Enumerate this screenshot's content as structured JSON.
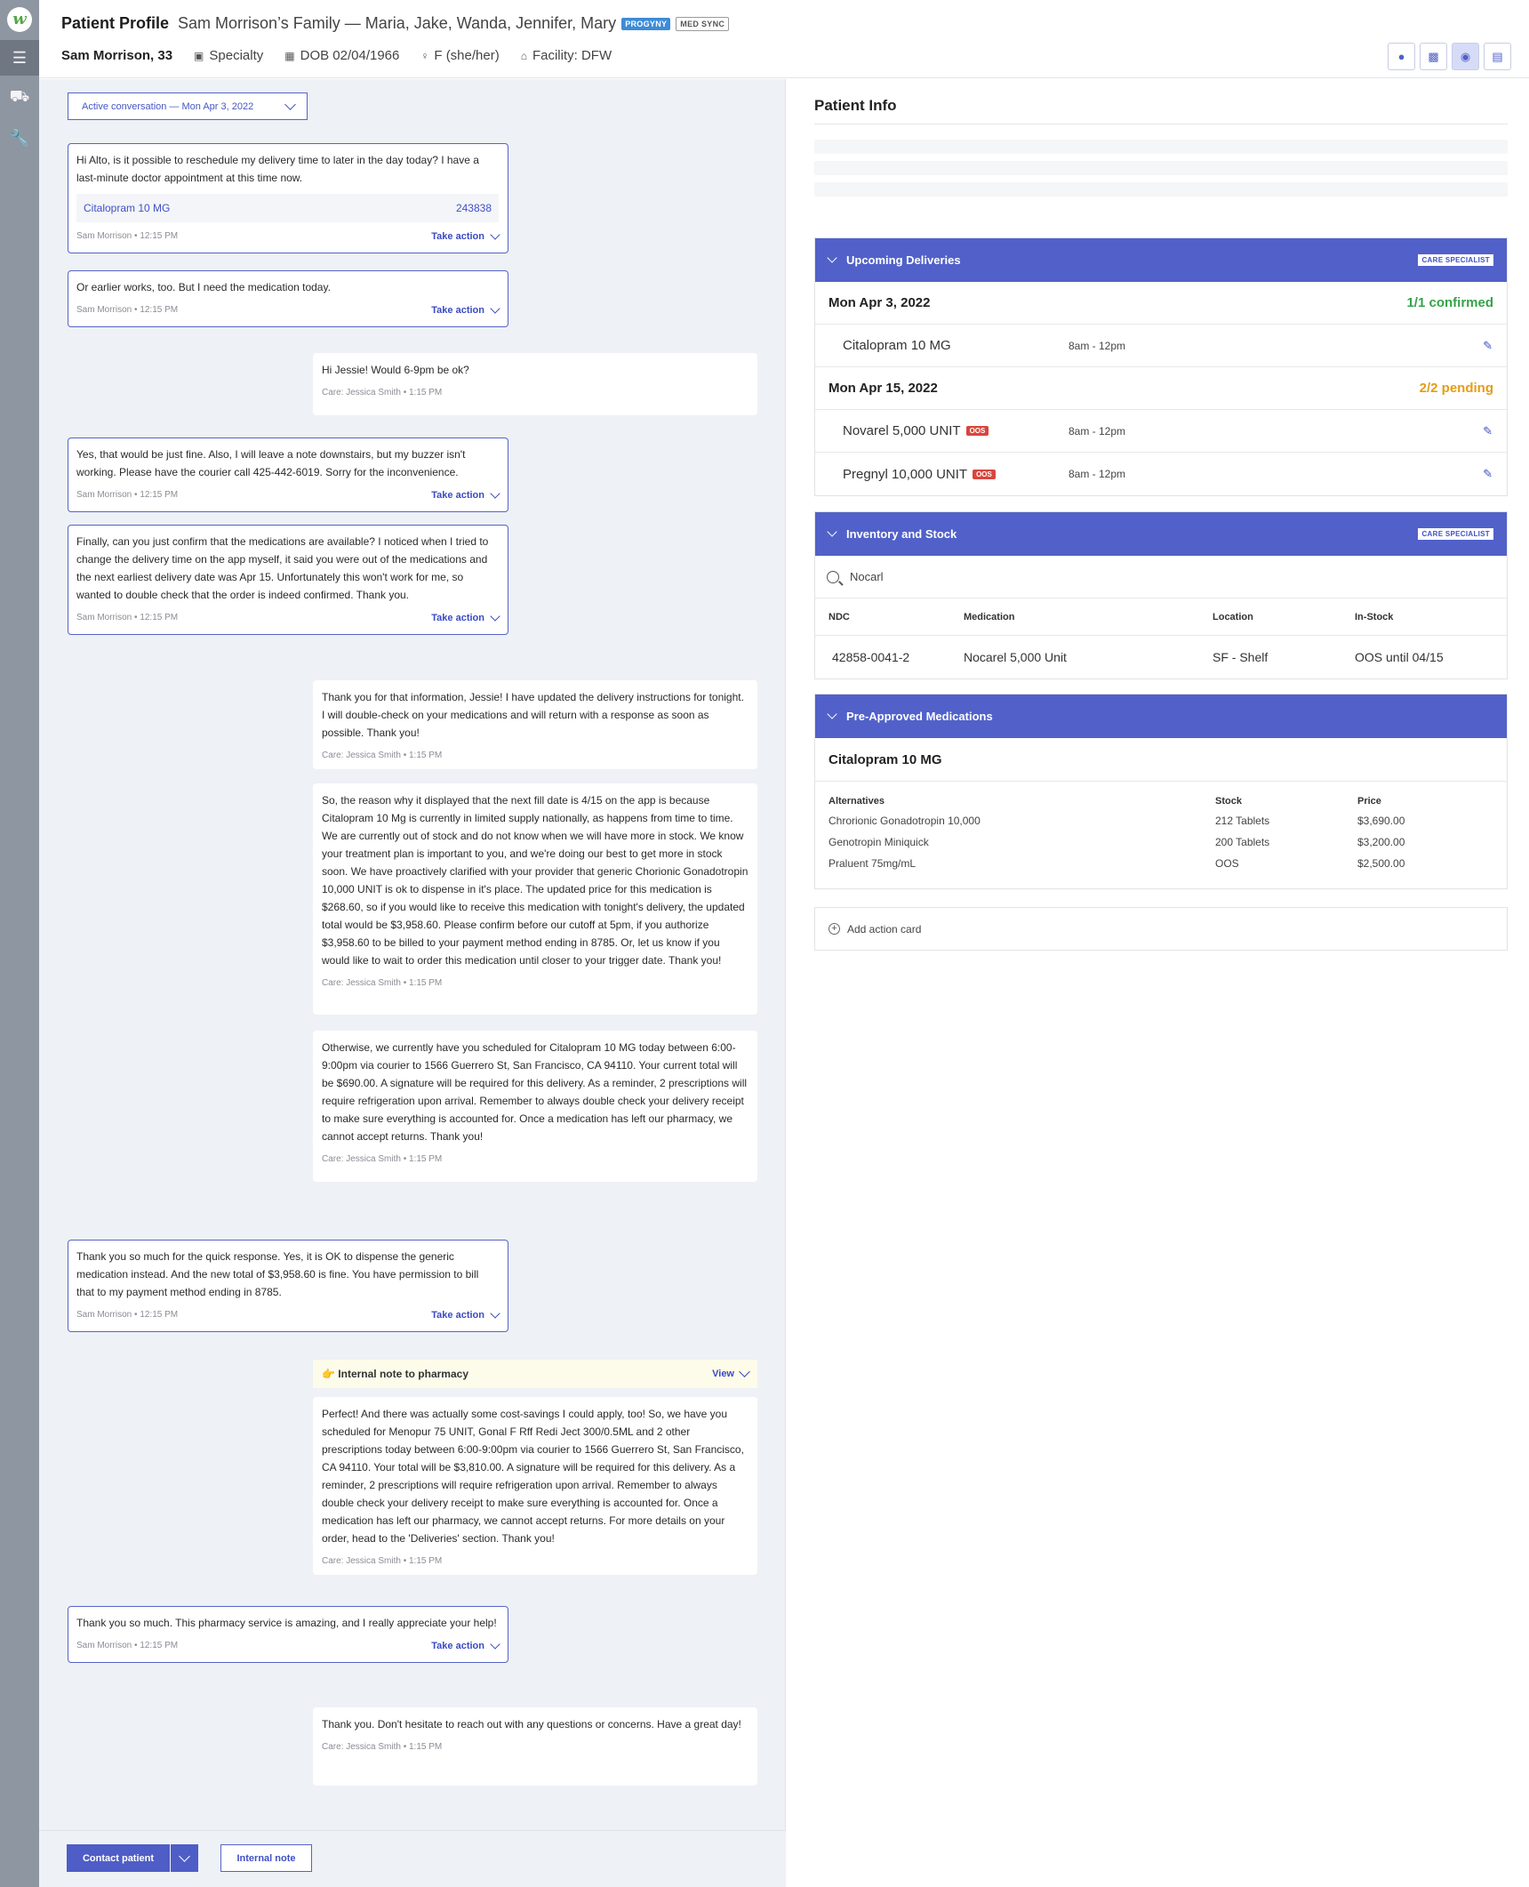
{
  "sidebar": {
    "logo": "w",
    "items": [
      "menu-icon",
      "truck-icon",
      "wrench-icon"
    ]
  },
  "header": {
    "title": "Patient Profile",
    "family": "Sam Morrison’s Family — Maria, Jake, Wanda, Jennifer, Mary",
    "badges": [
      "PROGYNY",
      "MED SYNC"
    ],
    "patient_name": "Sam Morrison, 33",
    "specialty": "Specialty",
    "dob": "DOB 02/04/1966",
    "gender": "F (she/her)",
    "facility": "Facility: DFW",
    "buttons": [
      "person-icon",
      "clipboard-icon",
      "chat-icon",
      "briefcase-icon"
    ]
  },
  "conversation": {
    "dropdown": "Active conversation — Mon Apr 3, 2022",
    "take_action": "Take action",
    "messages": [
      {
        "dir": "in",
        "text": "Hi Alto, is it possible to reschedule my delivery time to later in the day today? I have a last-minute doctor appointment at this time now.",
        "med": "Citalopram 10 MG",
        "med_id": "243838",
        "author": "Sam Morrison",
        "time": "12:15 PM"
      },
      {
        "dir": "in",
        "text": "Or earlier works, too. But I need the medication today.",
        "author": "Sam Morrison",
        "time": "12:15 PM"
      },
      {
        "dir": "out",
        "text": "Hi Jessie! Would 6-9pm be ok?",
        "author": "Care: Jessica Smith",
        "time": "1:15 PM"
      },
      {
        "dir": "in",
        "text": "Yes, that would be just fine. Also, I will leave a note downstairs, but my buzzer isn't working. Please have the courier call 425-442-6019. Sorry for the inconvenience.",
        "author": "Sam Morrison",
        "time": "12:15 PM"
      },
      {
        "dir": "in",
        "text": "Finally, can you just confirm that the medications are available? I noticed when I tried to change the delivery time on the app myself, it said you were out of the medications and the next earliest delivery date was Apr 15. Unfortunately this won't work for me, so wanted to double check that the order is indeed confirmed. Thank you.",
        "author": "Sam Morrison",
        "time": "12:15 PM"
      },
      {
        "dir": "out",
        "text": "Thank you for that information, Jessie! I have updated the delivery instructions for tonight. I will double-check on your medications and will return with a response as soon as possible. Thank you!",
        "author": "Care: Jessica Smith",
        "time": "1:15 PM"
      },
      {
        "dir": "out",
        "text": "So, the reason why it displayed that the next fill date is 4/15 on the app is because Citalopram 10 Mg is currently in limited supply nationally, as happens from time to time. We are currently out of stock and do not know when we will have more in stock. We know your treatment plan is important to you, and we're doing our best to get more in stock soon. We have proactively clarified with your provider that generic Chorionic Gonadotropin 10,000 UNIT is ok to dispense in it's place. The updated price for this medication is $268.60, so if you would like to receive this medication with tonight's delivery, the updated total would be $3,958.60. Please confirm before our cutoff at 5pm, if you authorize $3,958.60 to be billed to your payment method ending in 8785. Or, let us know if you would like to wait to order this medication until closer to your trigger date. Thank you!",
        "author": "Care: Jessica Smith",
        "time": "1:15 PM"
      },
      {
        "dir": "out",
        "text": "Otherwise, we currently have you scheduled for Citalopram 10 MG today between 6:00-9:00pm via courier to 1566 Guerrero St, San Francisco, CA 94110. Your current total will be $690.00. A signature will be required for this delivery. As a reminder, 2 prescriptions will require refrigeration upon arrival. Remember to always double check your delivery receipt to make sure everything is accounted for. Once a medication has left our pharmacy, we cannot accept returns. Thank you!",
        "author": "Care: Jessica Smith",
        "time": "1:15 PM"
      },
      {
        "dir": "in",
        "text": "Thank you so much for the quick response. Yes, it is OK to dispense the generic medication instead. And the new total of $3,958.60 is fine. You have permission to bill that to my payment method ending in 8785.",
        "author": "Sam Morrison",
        "time": "12:15 PM"
      },
      {
        "dir": "out",
        "text": "Perfect! And there was actually some cost-savings I could apply, too! So, we have you scheduled for Menopur 75 UNIT, Gonal F Rff Redi Ject 300/0.5ML and 2 other prescriptions today between 6:00-9:00pm via courier to 1566 Guerrero St, San Francisco, CA 94110. Your total will be $3,810.00. A signature will be required for this delivery. As a reminder, 2 prescriptions will require refrigeration upon arrival. Remember to always double check your delivery receipt to make sure everything is accounted for. Once a medication has left our pharmacy, we cannot accept returns. For more details on your order, head to the 'Deliveries' section. Thank you!",
        "author": "Care: Jessica Smith",
        "time": "1:15 PM"
      },
      {
        "dir": "in",
        "text": "Thank you so much. This pharmacy service is amazing, and I really appreciate your help!",
        "author": "Sam Morrison",
        "time": "12:15 PM"
      },
      {
        "dir": "out",
        "text": "Thank you. Don't hesitate to reach out with any questions or concerns. Have a great day!",
        "author": "Care: Jessica Smith",
        "time": "1:15 PM"
      }
    ],
    "internal_note": {
      "icon": "👉",
      "label": "Internal note to pharmacy",
      "view": "View"
    },
    "footer": {
      "contact": "Contact patient",
      "internal": "Internal note"
    }
  },
  "patient_info": {
    "title": "Patient Info",
    "upcoming": {
      "title": "Upcoming Deliveries",
      "badge": "CARE SPECIALIST",
      "groups": [
        {
          "date": "Mon Apr 3, 2022",
          "status": "1/1 confirmed",
          "items": [
            {
              "name": "Citalopram 10 MG",
              "oos": "",
              "time": "8am - 12pm"
            }
          ]
        },
        {
          "date": "Mon Apr 15, 2022",
          "status": "2/2 pending",
          "items": [
            {
              "name": "Novarel 5,000 UNIT",
              "oos": "OOS",
              "time": "8am - 12pm"
            },
            {
              "name": "Pregnyl 10,000 UNIT",
              "oos": "OOS",
              "time": "8am - 12pm"
            }
          ]
        }
      ]
    },
    "inventory": {
      "title": "Inventory and Stock",
      "badge": "CARE SPECIALIST",
      "search": "Nocarl",
      "columns": [
        "NDC",
        "Medication",
        "Location",
        "In-Stock"
      ],
      "rows": [
        [
          "42858-0041-2",
          "Nocarel 5,000 Unit",
          "SF - Shelf",
          "OOS until 04/15"
        ]
      ]
    },
    "preapproved": {
      "title": "Pre-Approved Medications",
      "medication": "Citalopram 10 MG",
      "columns": [
        "Alternatives",
        "Stock",
        "Price"
      ],
      "rows": [
        [
          "Chrorionic Gonadotropin 10,000",
          "212 Tablets",
          "$3,690.00"
        ],
        [
          "Genotropin Miniquick",
          "200 Tablets",
          "$3,200.00"
        ],
        [
          "Praluent 75mg/mL",
          "OOS",
          "$2,500.00"
        ]
      ]
    },
    "add_card": "Add action card"
  }
}
